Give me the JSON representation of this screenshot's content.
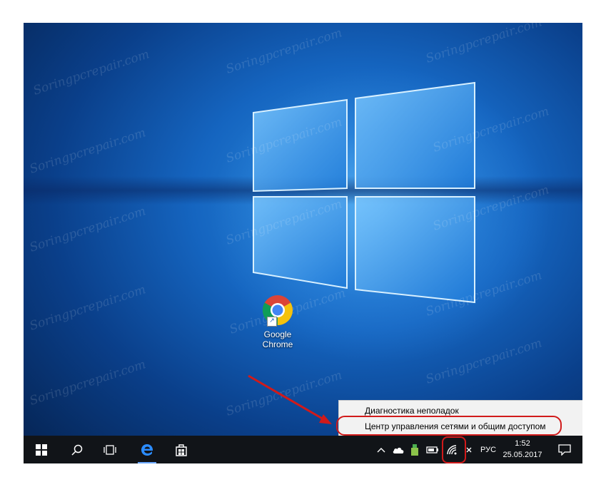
{
  "desktop": {
    "watermark": "Soringpcrepair.com",
    "icons": [
      {
        "label_line1": "Google",
        "label_line2": "Chrome",
        "icon": "chrome-icon"
      }
    ]
  },
  "context_menu": {
    "items": [
      {
        "label": "Диагностика неполадок"
      },
      {
        "label": "Центр управления сетями и общим доступом"
      }
    ]
  },
  "taskbar": {
    "buttons": [
      {
        "name": "start",
        "icon": "windows-logo-icon"
      },
      {
        "name": "search",
        "icon": "search-icon"
      },
      {
        "name": "task-view",
        "icon": "task-view-icon"
      },
      {
        "name": "edge",
        "icon": "edge-icon"
      },
      {
        "name": "store",
        "icon": "store-icon"
      }
    ],
    "tray": {
      "language": "РУС",
      "time": "1:52",
      "date": "25.05.2017"
    }
  },
  "colors": {
    "annotation_red": "#d11a1a",
    "taskbar": "#111418",
    "menu_bg": "#f2f2f2",
    "desktop_blue": "#1565c0"
  }
}
